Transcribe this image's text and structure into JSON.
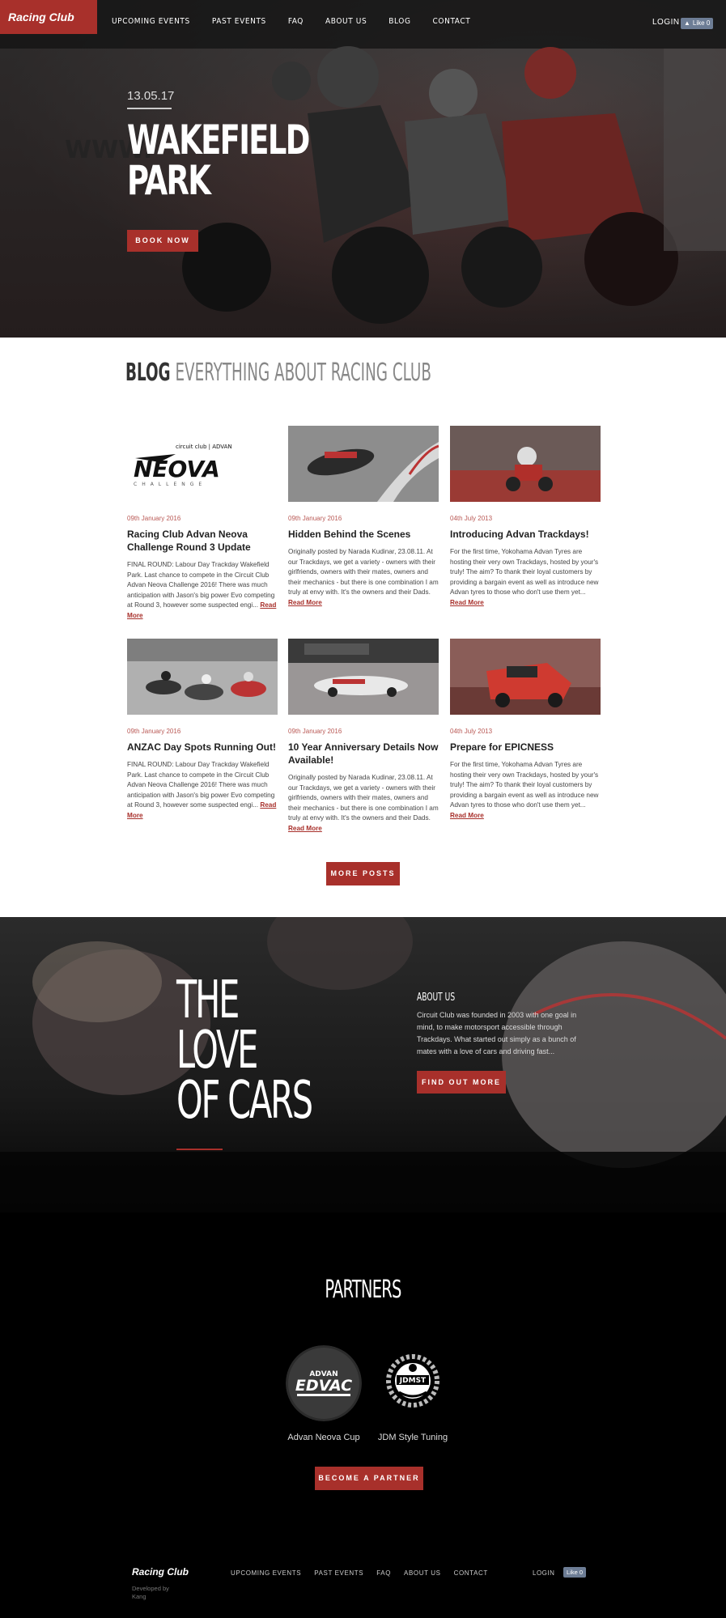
{
  "brand": {
    "name": "Racing Club",
    "accent": "#a8302b"
  },
  "nav": {
    "links": [
      "UPCOMING EVENTS",
      "PAST EVENTS",
      "FAQ",
      "ABOUT US",
      "BLOG",
      "CONTACT"
    ],
    "login": "LOGIN",
    "like": "Like 0"
  },
  "hero": {
    "date": "13.05.17",
    "title_line1": "WAKEFIELD",
    "title_line2": "PARK",
    "button": "BOOK NOW"
  },
  "blog": {
    "heading_bold": "BLOG",
    "heading_light": "EVERYTHING ABOUT RACING CLUB",
    "posts": [
      {
        "date": "09th January 2016",
        "title": "Racing Club Advan Neova Challenge Round 3 Update",
        "excerpt": "FINAL ROUND: Labour Day Trackday Wakefield Park. Last chance to compete in the Circuit Club Advan Neova Challenge 2016! There was much anticipation with Jason's big power Evo competing at Round 3, however some suspected engi...",
        "read_more": "Read More"
      },
      {
        "date": "09th January 2016",
        "title": "Hidden Behind the Scenes",
        "excerpt": "Originally posted by Narada Kudinar, 23.08.11. At our Trackdays, we get a variety - owners with their girlfriends, owners with their mates, owners and their mechanics - but there is one combination I am truly at envy with. It's the owners and their Dads.",
        "read_more": "Read More"
      },
      {
        "date": "04th July 2013",
        "title": "Introducing Advan Trackdays!",
        "excerpt": "For the first time, Yokohama Advan Tyres are hosting their very own Trackdays, hosted by your's truly! The aim? To thank their loyal customers by providing a bargain event as well as introduce new Advan tyres to those who don't use them yet...",
        "read_more": "Read More"
      },
      {
        "date": "09th January 2016",
        "title": "ANZAC Day Spots Running Out!",
        "excerpt": "FINAL ROUND: Labour Day Trackday Wakefield Park. Last chance to compete in the Circuit Club Advan Neova Challenge 2016! There was much anticipation with Jason's big power Evo competing at Round 3, however some suspected engi...",
        "read_more": "Read More"
      },
      {
        "date": "09th January 2016",
        "title": "10 Year Anniversary Details Now Available!",
        "excerpt": "Originally posted by Narada Kudinar, 23.08.11. At our Trackdays, we get a variety - owners with their girlfriends, owners with their mates, owners and their mechanics - but there is one combination I am truly at envy with. It's the owners and their Dads.",
        "read_more": "Read More"
      },
      {
        "date": "04th July 2013",
        "title": "Prepare for EPICNESS",
        "excerpt": "For the first time, Yokohama Advan Tyres are hosting their very own Trackdays, hosted by your's truly! The aim? To thank their loyal customers by providing a bargain event as well as introduce new Advan tyres to those who don't use them yet...",
        "read_more": "Read More"
      }
    ],
    "more_button": "MORE POSTS"
  },
  "love": {
    "title_line1": "THE",
    "title_line2": "LOVE",
    "title_line3": "OF CARS",
    "about_heading": "ABOUT US",
    "about_text": "Circuit Club was founded in 2003 with one goal in mind, to make motorsport accessible through Trackdays. What started out simply as a bunch of mates with a love of cars and driving fast...",
    "button": "FIND OUT MORE"
  },
  "partners": {
    "title": "PARTNERS",
    "items": [
      {
        "name": "Advan Neova Cup",
        "logo_text": "EDVAC",
        "logo_top": "ADVAN"
      },
      {
        "name": "JDM Style Tuning",
        "logo_text": "JDMST"
      }
    ],
    "button": "BECOME A PARTNER"
  },
  "footer": {
    "brand": "Racing Club",
    "developed": "Developed by Kang",
    "links": [
      "UPCOMING EVENTS",
      "PAST EVENTS",
      "FAQ",
      "ABOUT US",
      "CONTACT"
    ],
    "login": "LOGIN",
    "like": "Like 0"
  }
}
